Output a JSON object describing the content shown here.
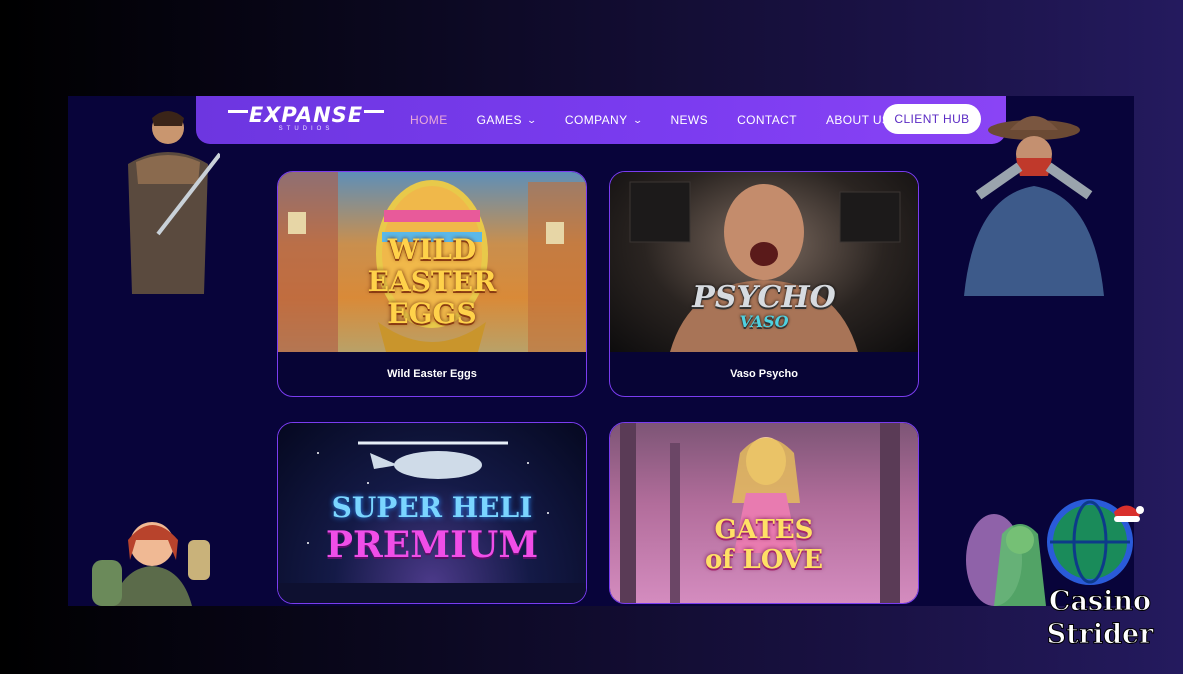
{
  "nav": {
    "logo_text": "EXPANSE",
    "logo_sub": "STUDIOS",
    "items": [
      {
        "label": "HOME",
        "active": true,
        "dropdown": false
      },
      {
        "label": "GAMES",
        "active": false,
        "dropdown": true
      },
      {
        "label": "COMPANY",
        "active": false,
        "dropdown": true
      },
      {
        "label": "NEWS",
        "active": false,
        "dropdown": false
      },
      {
        "label": "CONTACT",
        "active": false,
        "dropdown": false
      },
      {
        "label": "ABOUT US",
        "active": false,
        "dropdown": false
      }
    ],
    "client_hub_label": "CLIENT HUB",
    "chevron_icon": "chevron-down-icon"
  },
  "games": [
    {
      "title": "Wild Easter Eggs",
      "logo_lines": [
        "WILD",
        "EASTER",
        "EGGS"
      ]
    },
    {
      "title": "Vaso Psycho",
      "logo_lines": [
        "PSYCHO",
        "VASO"
      ]
    },
    {
      "title": "",
      "logo_lines": [
        "SUPER HELI",
        "PREMIUM"
      ]
    },
    {
      "title": "",
      "logo_lines": [
        "GATES",
        "of LOVE"
      ]
    }
  ],
  "watermark": {
    "line1": "Casino",
    "line2": "Strider"
  },
  "colors": {
    "nav_bg": "#7b3cf0",
    "page_bg": "#08043a",
    "card_border": "#7a3cf0",
    "active_link": "#e9a9d9"
  }
}
